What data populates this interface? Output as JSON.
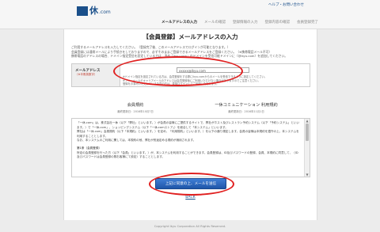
{
  "header": {
    "logo_mark": "一",
    "logo_text": "休",
    "logo_sub": ".com",
    "help": "ヘルプ・お問い合わせ",
    "steps": [
      {
        "label": "メールアドレスの入力",
        "active": true
      },
      {
        "label": "メールの確認",
        "active": false
      },
      {
        "label": "登録情報の入力",
        "active": false
      },
      {
        "label": "登録内容の確認",
        "active": false
      },
      {
        "label": "会員登録完了",
        "active": false
      }
    ]
  },
  "page": {
    "title": "【会員登録】メールアドレスの入力",
    "intro_lines": [
      "ご利用するメールアドレスを入力してください。（登録完了後、このメールアドレスでログインが可能となります。）",
      "会員登録には通常メールにより手続きをしておりますので、必ずそのままご登録できるメールアドレスをご登録ください。（※携帯電話メール不可）",
      "携帯電話のアドレスの場合、ドメイン指定受信を設定している方は、予め「ikyu.com」のドメインを受信可能ドメインに（@ikyu.com）を追加してください。"
    ],
    "intro_red": "携帯電話メール不可"
  },
  "form": {
    "label": "メールアドレス",
    "label_required": "（※半角英数字）",
    "email_value": "xxxxx@ikyu.com",
    "notes": [
      "※ドメイン指定を設定されている方は、会員登録をする際にikyu.comからのメールを受信できるように設定してください。",
      "※フリーメールやキャリアメールのアドレスは会員登録後にご利用いただけない場合がありますのでご注意ください。",
      "登録をお済みいただいている会員の方は、直接ログインしてご利用いただけます。"
    ]
  },
  "terms": {
    "left_title": "会員規約",
    "left_date": "最終更新日：2016年10月7日",
    "right_title": "一休コミュニケーション 利用規約",
    "right_date": "最終更新日：2016年11月1日",
    "paragraphs": [
      "「一休.com」は、株式会社一休（以下「弊社」といいます。）が会員の皆様にご提供するサイトで、弊社がホスト及びレストラン予約システム（以下「予約システム」といいます。）で「一休.com」、ショッピングシステム（以下「一休.comストア」）を総合して「本システム」といいます。",
      "弊社は「一休.com」会員規約（以下「本規約」といいます。）を定め、「利用規約」といいます。）を以下の通り規定します。会員の皆様は本規約を遵守の上、本システムを利用することとします。",
      "なお、本システムのご利用に関しては、本規約の他、弊社が別途定める規約が適用されます。"
    ],
    "section_title": "第1条（会員登録）",
    "section_text": "所定の会員登録を行った方（以下「会員」といいます。）が、本システムを利用することができます。会員登録は、ID及びパスワードの登録、会員、本規約に同意して、（ID及びパスワードは会員登録の際お客様にて設定）することとします。"
  },
  "actions": {
    "agree_button": "上記に同意の上、メールを送信",
    "back_link": "BACK"
  },
  "footer": {
    "copyright": "Copyright Ikyu Corporation All Rights Reserved."
  },
  "colors": {
    "accent": "#1a4f8a",
    "button": "#2a66c2",
    "annotation_ring": "#e02020"
  }
}
